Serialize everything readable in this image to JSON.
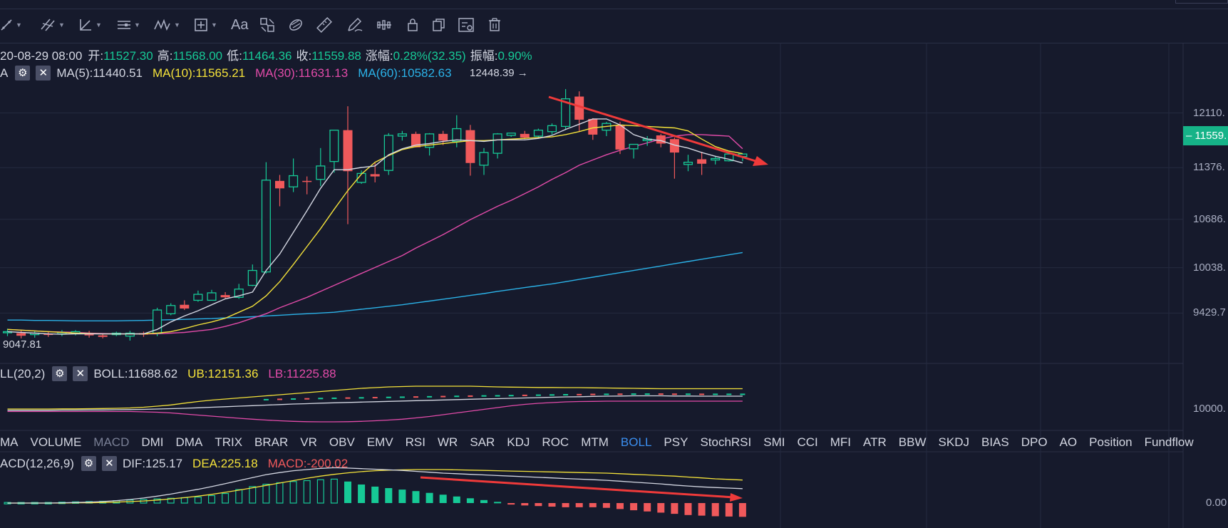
{
  "toolbar": {
    "icons": [
      "line-tool-icon",
      "parallel-channel-icon",
      "angle-tool-icon",
      "horizontal-lines-icon",
      "wave-tool-icon",
      "measure-box-icon",
      "text-tool-icon",
      "pattern-icon",
      "eraser-icon",
      "ruler-icon",
      "pencil-icon",
      "bars-icon",
      "lock-icon",
      "copy-icon",
      "settings-board-icon",
      "trash-icon"
    ],
    "text_tool_label": "Aa"
  },
  "ohlc": {
    "date": "20-08-29 08:00",
    "open_label": "开:",
    "open": "11527.30",
    "high_label": "高:",
    "high": "11568.00",
    "low_label": "低:",
    "low": "11464.36",
    "close_label": "收:",
    "close": "11559.88",
    "change_label": "涨幅:",
    "change": "0.28%(32.35)",
    "amp_label": "振幅:",
    "amp": "0.90%"
  },
  "ma_legend": {
    "name": "A",
    "ma5": "MA(5):11440.51",
    "ma10": "MA(10):11565.21",
    "ma30": "MA(30):11631.13",
    "ma60": "MA(60):10582.63"
  },
  "colors": {
    "bg": "#161a2c",
    "up": "#16c996",
    "down": "#f0595b",
    "ma5": "#d4d7e2",
    "ma10": "#f4e23a",
    "ma30": "#e24ba9",
    "ma60": "#2bb2e8",
    "grid": "#242a3f",
    "arrow": "#ef3a3a",
    "active_tab": "#3b8ff0"
  },
  "annotations": {
    "high_label": "12448.39 →",
    "low_label": "9047.81"
  },
  "price_axis": {
    "ticks": [
      {
        "v": 12110,
        "label": "12110."
      },
      {
        "v": 11376,
        "label": "11376."
      },
      {
        "v": 10686,
        "label": "10686."
      },
      {
        "v": 10038,
        "label": "10038."
      },
      {
        "v": 9429,
        "label": "9429.7"
      }
    ],
    "current_price": "11559."
  },
  "boll_legend": {
    "name": "LL(20,2)",
    "boll": "BOLL:11688.62",
    "ub": "UB:12151.36",
    "lb": "LB:11225.88"
  },
  "boll_axis": {
    "label": "10000."
  },
  "indicator_tabs": [
    {
      "label": "MA"
    },
    {
      "label": "VOLUME"
    },
    {
      "label": "MACD",
      "dim": true
    },
    {
      "label": "DMI"
    },
    {
      "label": "DMA"
    },
    {
      "label": "TRIX"
    },
    {
      "label": "BRAR"
    },
    {
      "label": "VR"
    },
    {
      "label": "OBV"
    },
    {
      "label": "EMV"
    },
    {
      "label": "RSI"
    },
    {
      "label": "WR"
    },
    {
      "label": "SAR"
    },
    {
      "label": "KDJ"
    },
    {
      "label": "ROC"
    },
    {
      "label": "MTM"
    },
    {
      "label": "BOLL",
      "active": true
    },
    {
      "label": "PSY"
    },
    {
      "label": "StochRSI"
    },
    {
      "label": "SMI"
    },
    {
      "label": "CCI"
    },
    {
      "label": "MFI"
    },
    {
      "label": "ATR"
    },
    {
      "label": "BBW"
    },
    {
      "label": "SKDJ"
    },
    {
      "label": "BIAS"
    },
    {
      "label": "DPO"
    },
    {
      "label": "AO"
    },
    {
      "label": "Position"
    },
    {
      "label": "Fundflow"
    }
  ],
  "macd_legend": {
    "name": "ACD(12,26,9)",
    "dif": "DIF:125.17",
    "dea": "DEA:225.18",
    "macd": "MACD:-200.02"
  },
  "macd_axis": {
    "label": "0.00"
  },
  "chart_data": {
    "type": "candlestick",
    "y_range": [
      8850,
      12650
    ],
    "candles": [
      [
        9165,
        9180,
        9120,
        9220
      ],
      [
        9160,
        9125,
        9090,
        9200
      ],
      [
        9140,
        9160,
        9100,
        9190
      ],
      [
        9150,
        9140,
        9110,
        9185
      ],
      [
        9150,
        9170,
        9120,
        9200
      ],
      [
        9160,
        9180,
        9130,
        9200
      ],
      [
        9160,
        9130,
        9100,
        9190
      ],
      [
        9130,
        9110,
        9090,
        9150
      ],
      [
        9140,
        9160,
        9120,
        9180
      ],
      [
        9120,
        9160,
        9060,
        9190
      ],
      [
        9160,
        9140,
        9110,
        9180
      ],
      [
        9160,
        9470,
        9120,
        9500
      ],
      [
        9420,
        9530,
        9400,
        9560
      ],
      [
        9540,
        9490,
        9470,
        9600
      ],
      [
        9600,
        9680,
        9580,
        9730
      ],
      [
        9600,
        9700,
        9600,
        9740
      ],
      [
        9670,
        9640,
        9620,
        9710
      ],
      [
        9640,
        9750,
        9620,
        9820
      ],
      [
        9800,
        10000,
        9790,
        10080
      ],
      [
        9980,
        11210,
        9960,
        11450
      ],
      [
        11200,
        11100,
        10860,
        11280
      ],
      [
        11120,
        11270,
        11050,
        11500
      ],
      [
        11200,
        11190,
        11020,
        11260
      ],
      [
        11220,
        11400,
        11130,
        11640
      ],
      [
        11460,
        11880,
        11310,
        11880
      ],
      [
        11880,
        11330,
        10620,
        12200
      ],
      [
        11180,
        11300,
        11160,
        11340
      ],
      [
        11290,
        11260,
        11180,
        11440
      ],
      [
        11340,
        11810,
        11280,
        11840
      ],
      [
        11800,
        11830,
        11740,
        11870
      ],
      [
        11830,
        11650,
        11650,
        11860
      ],
      [
        11650,
        11830,
        11540,
        11840
      ],
      [
        11830,
        11740,
        11680,
        11870
      ],
      [
        11730,
        11900,
        11650,
        12080
      ],
      [
        11880,
        11440,
        11270,
        11950
      ],
      [
        11410,
        11580,
        11280,
        11640
      ],
      [
        11570,
        11830,
        11500,
        11840
      ],
      [
        11810,
        11840,
        11790,
        11840
      ],
      [
        11830,
        11780,
        11760,
        11870
      ],
      [
        11800,
        11880,
        11770,
        11900
      ],
      [
        11860,
        11940,
        11820,
        11970
      ],
      [
        11930,
        12300,
        11890,
        12430
      ],
      [
        12330,
        12020,
        11860,
        12400
      ],
      [
        12030,
        11820,
        11750,
        12040
      ],
      [
        11880,
        11970,
        11800,
        11990
      ],
      [
        11950,
        11620,
        11560,
        11990
      ],
      [
        11630,
        11690,
        11500,
        11690
      ],
      [
        11740,
        11760,
        11670,
        11800
      ],
      [
        11810,
        11700,
        11650,
        11830
      ],
      [
        11760,
        11580,
        11230,
        11780
      ],
      [
        11420,
        11450,
        11330,
        11550
      ],
      [
        11490,
        11430,
        11280,
        11590
      ],
      [
        11480,
        11500,
        11420,
        11530
      ],
      [
        11470,
        11560,
        11460,
        11580
      ],
      [
        11527,
        11560,
        11464,
        11568
      ]
    ],
    "ma5": [
      9180,
      9170,
      9160,
      9150,
      9145,
      9150,
      9150,
      9150,
      9150,
      9150,
      9150,
      9210,
      9310,
      9390,
      9460,
      9540,
      9620,
      9660,
      9710,
      10000,
      10220,
      10510,
      10800,
      11100,
      11350,
      11350,
      11380,
      11400,
      11550,
      11630,
      11680,
      11700,
      11730,
      11750,
      11740,
      11730,
      11750,
      11750,
      11750,
      11770,
      11810,
      11890,
      11960,
      12030,
      12030,
      11950,
      11820,
      11760,
      11740,
      11680,
      11640,
      11580,
      11530,
      11490,
      11440
    ],
    "ma10": [
      9210,
      9200,
      9190,
      9180,
      9170,
      9160,
      9155,
      9150,
      9150,
      9150,
      9150,
      9160,
      9180,
      9220,
      9270,
      9310,
      9360,
      9440,
      9520,
      9660,
      9850,
      10080,
      10320,
      10560,
      10820,
      11070,
      11290,
      11450,
      11540,
      11620,
      11660,
      11680,
      11700,
      11720,
      11740,
      11740,
      11750,
      11760,
      11770,
      11780,
      11790,
      11820,
      11860,
      11910,
      11930,
      11950,
      11940,
      11930,
      11920,
      11910,
      11870,
      11760,
      11660,
      11600,
      11565
    ],
    "ma30": [
      9210,
      9200,
      9190,
      9180,
      9175,
      9170,
      9160,
      9155,
      9150,
      9150,
      9150,
      9150,
      9160,
      9170,
      9190,
      9210,
      9250,
      9300,
      9360,
      9420,
      9500,
      9570,
      9640,
      9720,
      9800,
      9880,
      9960,
      10040,
      10120,
      10200,
      10300,
      10390,
      10480,
      10580,
      10680,
      10770,
      10860,
      10940,
      11030,
      11120,
      11220,
      11310,
      11410,
      11480,
      11550,
      11610,
      11660,
      11710,
      11760,
      11800,
      11820,
      11820,
      11810,
      11800,
      11631
    ],
    "ma60": [
      9335,
      9335,
      9330,
      9330,
      9328,
      9325,
      9325,
      9325,
      9325,
      9328,
      9330,
      9335,
      9340,
      9345,
      9350,
      9355,
      9365,
      9370,
      9380,
      9390,
      9400,
      9410,
      9420,
      9430,
      9440,
      9460,
      9480,
      9500,
      9520,
      9540,
      9565,
      9590,
      9615,
      9640,
      9665,
      9690,
      9720,
      9745,
      9770,
      9795,
      9820,
      9850,
      9880,
      9910,
      9940,
      9970,
      10000,
      10030,
      10060,
      10090,
      10120,
      10150,
      10180,
      10210,
      10240
    ],
    "boll_mid": [
      -0.35,
      -0.35,
      -0.35,
      -0.35,
      -0.34,
      -0.34,
      -0.33,
      -0.33,
      -0.32,
      -0.31,
      -0.3,
      -0.28,
      -0.26,
      -0.24,
      -0.21,
      -0.18,
      -0.15,
      -0.12,
      -0.09,
      -0.06,
      -0.03,
      0.0,
      0.02,
      0.05,
      0.07,
      0.09,
      0.11,
      0.13,
      0.15,
      0.17,
      0.19,
      0.21,
      0.23,
      0.25,
      0.27,
      0.29,
      0.3,
      0.32,
      0.34,
      0.36,
      0.38,
      0.4,
      0.41,
      0.43,
      0.44,
      0.45,
      0.46,
      0.46,
      0.46,
      0.45,
      0.45,
      0.44,
      0.44,
      0.44,
      0.44
    ],
    "boll_up": [
      -0.28,
      -0.28,
      -0.28,
      -0.28,
      -0.27,
      -0.27,
      -0.26,
      -0.25,
      -0.24,
      -0.22,
      -0.18,
      -0.12,
      -0.05,
      0.05,
      0.14,
      0.22,
      0.28,
      0.34,
      0.4,
      0.46,
      0.52,
      0.58,
      0.64,
      0.7,
      0.76,
      0.82,
      0.88,
      0.92,
      0.96,
      0.98,
      1.0,
      1.0,
      1.0,
      1.0,
      1.0,
      0.98,
      0.96,
      0.95,
      0.94,
      0.93,
      0.93,
      0.92,
      0.92,
      0.91,
      0.9,
      0.89,
      0.88,
      0.87,
      0.86,
      0.86,
      0.86,
      0.86,
      0.86,
      0.86,
      0.86
    ],
    "boll_low": [
      -0.42,
      -0.42,
      -0.42,
      -0.42,
      -0.42,
      -0.42,
      -0.42,
      -0.42,
      -0.42,
      -0.42,
      -0.44,
      -0.46,
      -0.5,
      -0.56,
      -0.62,
      -0.68,
      -0.74,
      -0.8,
      -0.85,
      -0.9,
      -0.94,
      -0.97,
      -0.99,
      -1.0,
      -1.0,
      -0.99,
      -0.97,
      -0.94,
      -0.9,
      -0.85,
      -0.78,
      -0.7,
      -0.6,
      -0.5,
      -0.4,
      -0.3,
      -0.2,
      -0.1,
      -0.02,
      0.04,
      0.08,
      0.12,
      0.14,
      0.15,
      0.16,
      0.16,
      0.16,
      0.16,
      0.16,
      0.16,
      0.16,
      0.16,
      0.16,
      0.16,
      0.16
    ],
    "macd_hist": [
      0.02,
      0.02,
      0.02,
      0.02,
      0.03,
      0.04,
      0.05,
      0.06,
      0.08,
      0.1,
      0.12,
      0.14,
      0.16,
      0.18,
      0.2,
      0.25,
      0.32,
      0.45,
      0.55,
      0.63,
      0.68,
      0.72,
      0.75,
      0.78,
      0.8,
      0.72,
      0.62,
      0.55,
      0.5,
      0.45,
      0.4,
      0.34,
      0.28,
      0.22,
      0.16,
      0.1,
      0.04,
      -0.05,
      -0.08,
      -0.1,
      -0.12,
      -0.14,
      -0.14,
      -0.14,
      -0.16,
      -0.2,
      -0.24,
      -0.28,
      -0.32,
      -0.36,
      -0.4,
      -0.42,
      -0.44,
      -0.45,
      -0.46
    ],
    "macd_dif": [
      0.0,
      0.0,
      0.0,
      0.0,
      0.01,
      0.02,
      0.03,
      0.05,
      0.08,
      0.12,
      0.17,
      0.23,
      0.3,
      0.38,
      0.46,
      0.55,
      0.65,
      0.75,
      0.85,
      0.95,
      1.02,
      1.08,
      1.12,
      1.16,
      1.18,
      1.17,
      1.15,
      1.13,
      1.11,
      1.09,
      1.06,
      1.03,
      1.0,
      0.98,
      0.96,
      0.94,
      0.92,
      0.9,
      0.88,
      0.86,
      0.84,
      0.82,
      0.8,
      0.78,
      0.76,
      0.73,
      0.7,
      0.67,
      0.64,
      0.6,
      0.57,
      0.54,
      0.52,
      0.5,
      0.48
    ],
    "macd_dea": [
      0.0,
      0.0,
      0.0,
      0.0,
      0.0,
      0.01,
      0.01,
      0.02,
      0.03,
      0.05,
      0.07,
      0.1,
      0.14,
      0.18,
      0.23,
      0.29,
      0.36,
      0.43,
      0.51,
      0.59,
      0.67,
      0.75,
      0.83,
      0.9,
      0.96,
      1.01,
      1.05,
      1.08,
      1.1,
      1.11,
      1.12,
      1.12,
      1.12,
      1.11,
      1.1,
      1.09,
      1.08,
      1.07,
      1.06,
      1.05,
      1.04,
      1.03,
      1.02,
      1.01,
      1.0,
      0.98,
      0.96,
      0.94,
      0.92,
      0.9,
      0.87,
      0.84,
      0.81,
      0.79,
      0.77
    ]
  }
}
